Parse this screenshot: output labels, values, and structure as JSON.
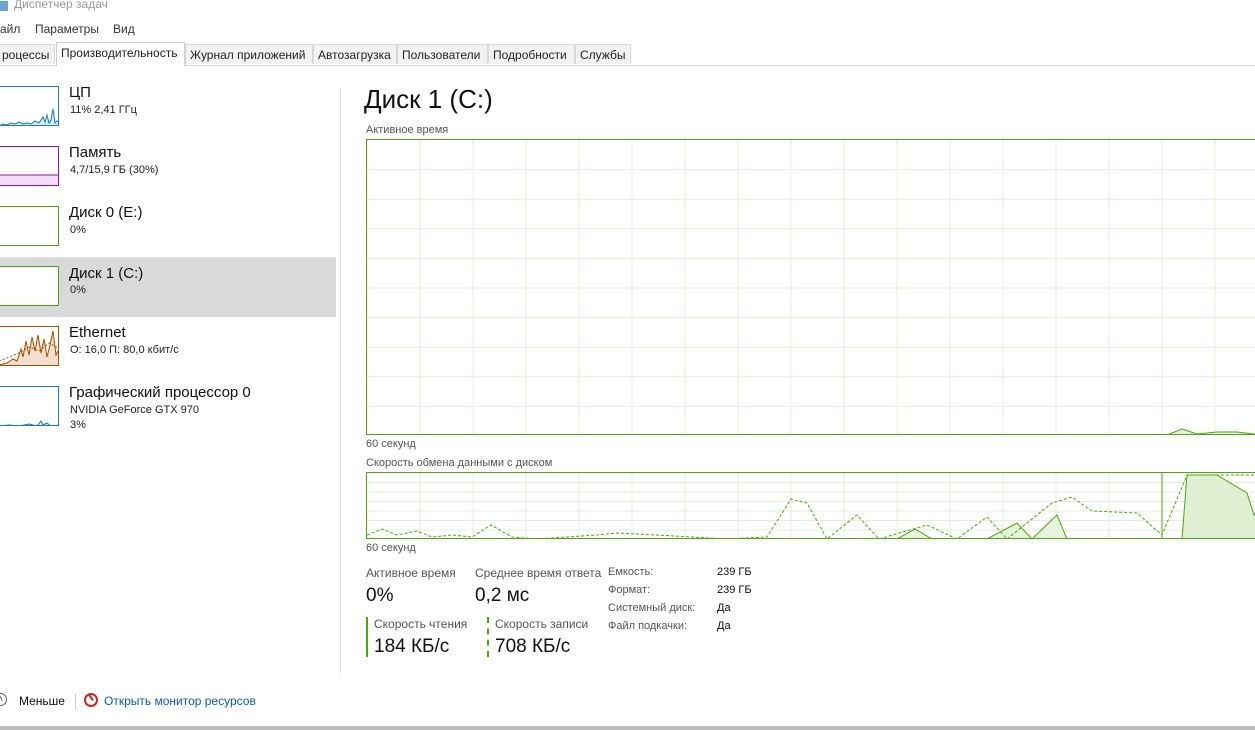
{
  "window": {
    "title": "Диспетчер задач"
  },
  "menu": {
    "file": "айл",
    "options": "Параметры",
    "view": "Вид"
  },
  "tabs": [
    {
      "label": "роцессы"
    },
    {
      "label": "Производительность"
    },
    {
      "label": "Журнал приложений"
    },
    {
      "label": "Автозагрузка"
    },
    {
      "label": "Пользователи"
    },
    {
      "label": "Подробности"
    },
    {
      "label": "Службы"
    }
  ],
  "sidebar": {
    "items": [
      {
        "name": "ЦП",
        "value": "11%  2,41 ГГц",
        "color": "#1b7cc0"
      },
      {
        "name": "Память",
        "value": "4,7/15,9 ГБ (30%)",
        "color": "#8b12ae"
      },
      {
        "name": "Диск 0 (E:)",
        "value": "0%",
        "color": "#4da60c"
      },
      {
        "name": "Диск 1 (C:)",
        "value": "0%",
        "color": "#4da60c"
      },
      {
        "name": "Ethernet",
        "value": "О: 16,0  П: 80,0 кбит/с",
        "color": "#a74f01"
      },
      {
        "name": "Графический процессор 0",
        "subtitle": "NVIDIA GeForce GTX 970",
        "value": "3%",
        "color": "#1b7cc0"
      }
    ]
  },
  "main": {
    "title": "Диск 1 (C:)",
    "chart1_label": "Активное время",
    "chart1_time": "60 секунд",
    "chart2_label": "Скорость обмена данными с диском",
    "chart2_time": "60 секунд",
    "accent": "#4da60c"
  },
  "stats": {
    "active_time_label": "Активное время",
    "active_time_value": "0%",
    "response_label": "Среднее время ответа",
    "response_value": "0,2 мс",
    "read_label": "Скорость чтения",
    "read_value": "184 КБ/с",
    "write_label": "Скорость записи",
    "write_value": "708 КБ/с"
  },
  "properties": {
    "capacity_label": "Емкость:",
    "capacity_value": "239 ГБ",
    "format_label": "Формат:",
    "format_value": "239 ГБ",
    "system_label": "Системный диск:",
    "system_value": "Да",
    "pagefile_label": "Файл подкачки:",
    "pagefile_value": "Да"
  },
  "footer": {
    "less_label": "Меньше",
    "monitor_label": "Открыть монитор ресурсов"
  }
}
